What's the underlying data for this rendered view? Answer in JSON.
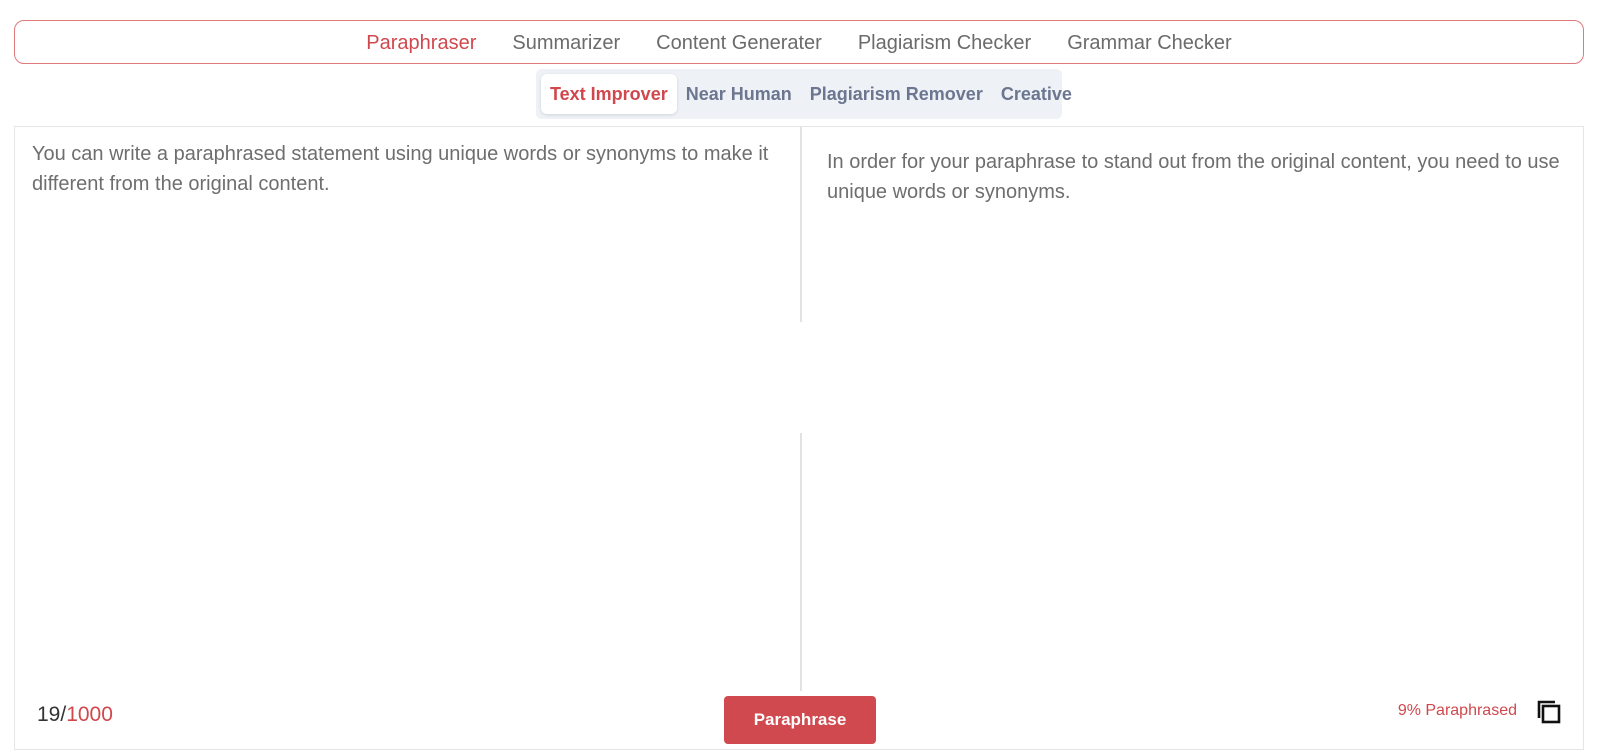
{
  "top_nav": {
    "tabs": [
      {
        "label": "Paraphraser",
        "active": true
      },
      {
        "label": "Summarizer",
        "active": false
      },
      {
        "label": "Content Generater",
        "active": false
      },
      {
        "label": "Plagiarism Checker",
        "active": false
      },
      {
        "label": "Grammar Checker",
        "active": false
      }
    ]
  },
  "modes": [
    {
      "label": "Text Improver",
      "active": true
    },
    {
      "label": "Near Human",
      "active": false
    },
    {
      "label": "Plagiarism Remover",
      "active": false
    },
    {
      "label": "Creative",
      "active": false
    }
  ],
  "editor": {
    "input_text": "You can write a paraphrased statement using unique words or synonyms to make it different from the original content.",
    "output_text": "In order for your paraphrase to stand out from the original content, you need to use unique words or synonyms.",
    "word_count": "19",
    "separator": "/",
    "word_limit": "1000",
    "button_label": "Paraphrase",
    "paraphrased_stat": "9% Paraphrased",
    "copy_icon": "copy-icon"
  },
  "colors": {
    "accent": "#d0484d",
    "mode_bar_bg": "#eef2f6",
    "border": "#e0797c"
  }
}
